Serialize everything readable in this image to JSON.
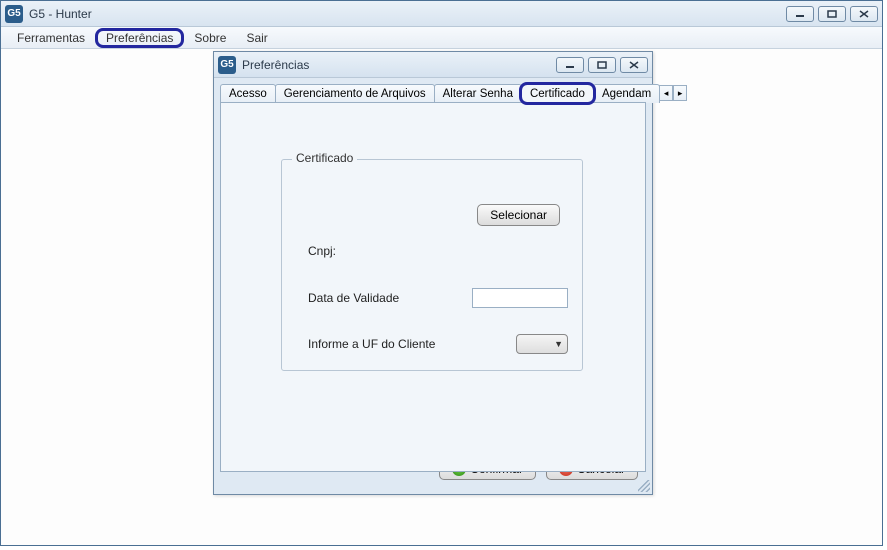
{
  "app": {
    "icon_text": "G5",
    "title": "G5 - Hunter"
  },
  "menubar": {
    "items": [
      "Ferramentas",
      "Preferências",
      "Sobre",
      "Sair"
    ],
    "highlighted_index": 1
  },
  "dialog": {
    "title": "Preferências",
    "tabs": [
      "Acesso",
      "Gerenciamento de Arquivos",
      "Alterar Senha",
      "Certificado",
      "Agendam"
    ],
    "active_tab_index": 3,
    "highlighted_tab_index": 3,
    "tab_scroll_visible": true,
    "certificado": {
      "group_label": "Certificado",
      "selecionar_label": "Selecionar",
      "cnpj_label": "Cnpj:",
      "cnpj_value": "",
      "data_validade_label": "Data de Validade",
      "data_validade_value": "",
      "uf_label": "Informe a UF do Cliente",
      "uf_value": ""
    },
    "confirm_label": "Confirmar",
    "cancel_label": "Cancelar"
  }
}
